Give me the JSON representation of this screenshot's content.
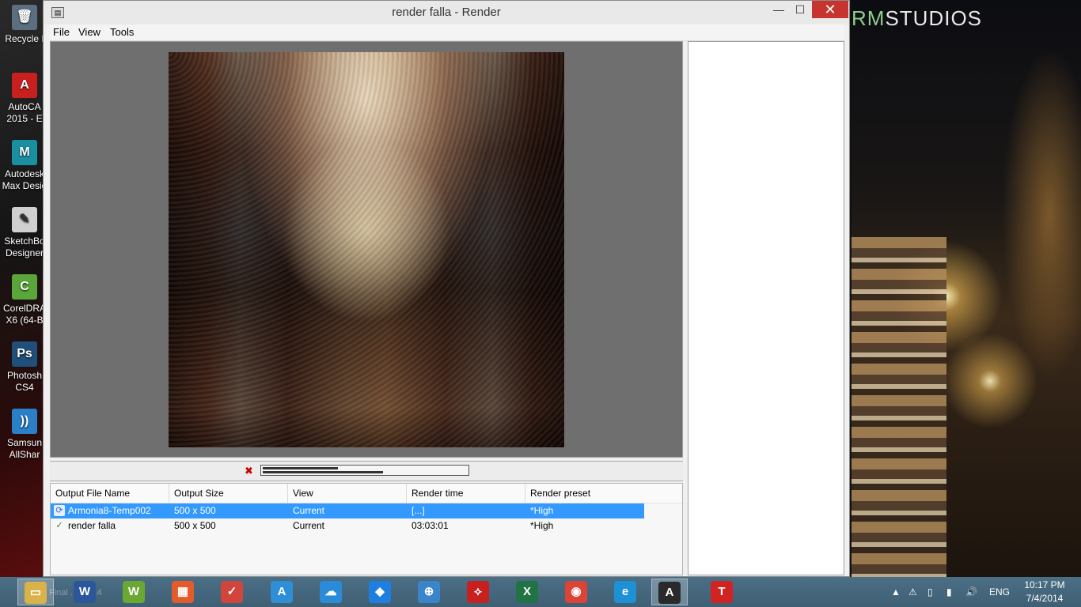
{
  "desktop": {
    "brand_prefix": "RM",
    "brand_suffix": "STUDIOS",
    "icons": [
      {
        "label": "Recycle I",
        "icon": "recycle-bin-icon"
      },
      {
        "label": "AutoCA",
        "label2": "2015 - E",
        "icon": "autocad-icon"
      },
      {
        "label": "Autodesk",
        "label2": "Max Desig",
        "icon": "3ds-max-icon"
      },
      {
        "label": "SketchBo",
        "label2": "Designer",
        "icon": "sketchbook-icon"
      },
      {
        "label": "CorelDRA",
        "label2": "X6 (64-B",
        "icon": "coreldraw-icon"
      },
      {
        "label": "Photosh",
        "label2": "CS4",
        "icon": "photoshop-icon"
      },
      {
        "label": "Samsun",
        "label2": "AllShar",
        "icon": "samsung-allshare-icon"
      }
    ]
  },
  "window": {
    "title": "render falla - Render",
    "minimize": "—",
    "maximize": "☐",
    "close": "✕",
    "menu": [
      "File",
      "View",
      "Tools"
    ]
  },
  "progress": {
    "top_fraction": 0.37,
    "bottom_fraction": 0.59
  },
  "queue": {
    "columns": [
      "Output File Name",
      "Output Size",
      "View",
      "Render time",
      "Render preset"
    ],
    "rows": [
      {
        "name": "Armonia8-Temp002",
        "size": "500 x 500",
        "view": "Current",
        "time": "[...]",
        "preset": "*High",
        "selected": true
      },
      {
        "name": "render falla",
        "size": "500 x 500",
        "view": "Current",
        "time": "03:03:01",
        "preset": "*High",
        "selected": false
      }
    ]
  },
  "taskbar": {
    "status_ghost": "Final ... : 37.4",
    "apps": [
      {
        "icon": "file-explorer-icon",
        "glyph": "▭",
        "color": "#d9b24a"
      },
      {
        "icon": "word-icon",
        "glyph": "W",
        "color": "#2b579a"
      },
      {
        "icon": "weebly-icon",
        "glyph": "W",
        "color": "#6aa832"
      },
      {
        "icon": "tiles-app-icon",
        "glyph": "▦",
        "color": "#e35b2b"
      },
      {
        "icon": "todoist-icon",
        "glyph": "✓",
        "color": "#d1453b"
      },
      {
        "icon": "autodesk-a-icon",
        "glyph": "A",
        "color": "#2f8fd6"
      },
      {
        "icon": "cloud-sync-icon",
        "glyph": "☁",
        "color": "#2a8cd8"
      },
      {
        "icon": "dropbox-icon",
        "glyph": "◆",
        "color": "#1f7fe0"
      },
      {
        "icon": "safari-icon",
        "glyph": "⊕",
        "color": "#3a84c9"
      },
      {
        "icon": "acrobat-icon",
        "glyph": "⟡",
        "color": "#c8201f"
      },
      {
        "icon": "excel-icon",
        "glyph": "X",
        "color": "#217346"
      },
      {
        "icon": "chrome-icon",
        "glyph": "◉",
        "color": "#db4437"
      },
      {
        "icon": "internet-explorer-icon",
        "glyph": "e",
        "color": "#1e90d6"
      },
      {
        "icon": "3ds-max-taskbar-icon",
        "glyph": "A",
        "color": "#2a2a2a"
      },
      {
        "icon": "teamviewer-icon",
        "glyph": "T",
        "color": "#d22323"
      }
    ],
    "tray": {
      "language": "ENG",
      "time": "10:17 PM",
      "date": "7/4/2014"
    }
  }
}
